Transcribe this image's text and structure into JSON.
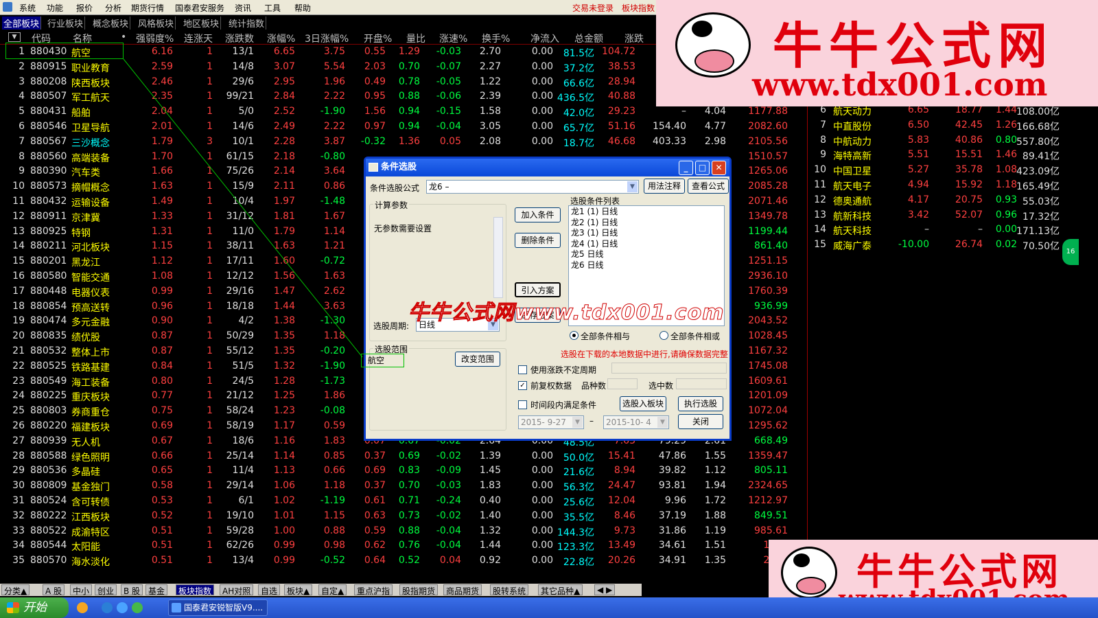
{
  "menubar": {
    "items": [
      "系统",
      "功能",
      "报价",
      "分析",
      "期货行情",
      "国泰君安服务",
      "资讯",
      "工具",
      "帮助"
    ],
    "right1": "交易未登录",
    "right2": "板块指数"
  },
  "tabs": [
    "全部板块",
    "行业板块",
    "概念板块",
    "风格板块",
    "地区板块",
    "统计指数"
  ],
  "columns": [
    "代码",
    "名称",
    "•",
    "强弱度%",
    "连涨天",
    "涨跌数",
    "涨幅%",
    "3日涨幅%",
    "开盘%",
    "量比",
    "涨速%",
    "换手%",
    "净流入",
    "总金额",
    "涨跌"
  ],
  "rows": [
    [
      "1",
      "880430",
      "航空",
      "6.16",
      "1",
      "13/1",
      "6.65",
      "3.75",
      "0.55",
      "1.29",
      "-0.03",
      "2.70",
      "0.00",
      "81.5亿",
      "104.72",
      "",
      "",
      ""
    ],
    [
      "2",
      "880915",
      "职业教育",
      "2.59",
      "1",
      "14/8",
      "3.07",
      "5.54",
      "2.03",
      "0.70",
      "-0.07",
      "2.27",
      "0.00",
      "37.2亿",
      "38.53",
      "",
      "",
      ""
    ],
    [
      "3",
      "880208",
      "陕西板块",
      "2.46",
      "1",
      "29/6",
      "2.95",
      "1.96",
      "0.49",
      "0.78",
      "-0.05",
      "1.22",
      "0.00",
      "66.6亿",
      "28.94",
      "",
      "",
      ""
    ],
    [
      "4",
      "880507",
      "军工航天",
      "2.35",
      "1",
      "99/21",
      "2.84",
      "2.22",
      "0.95",
      "0.88",
      "-0.06",
      "2.39",
      "0.00",
      "436.5亿",
      "40.88",
      "",
      "",
      ""
    ],
    [
      "5",
      "880431",
      "船舶",
      "2.04",
      "1",
      "5/0",
      "2.52",
      "-1.90",
      "1.56",
      "0.94",
      "-0.15",
      "1.58",
      "0.00",
      "42.0亿",
      "29.23",
      "–",
      "4.04",
      "1177.88"
    ],
    [
      "6",
      "880546",
      "卫星导航",
      "2.01",
      "1",
      "14/6",
      "2.49",
      "2.22",
      "0.97",
      "0.94",
      "-0.04",
      "3.05",
      "0.00",
      "65.7亿",
      "51.16",
      "154.40",
      "4.77",
      "2082.60"
    ],
    [
      "7",
      "880567",
      "三沙概念",
      "1.79",
      "3",
      "10/1",
      "2.28",
      "3.87",
      "-0.32",
      "1.36",
      "0.05",
      "2.08",
      "0.00",
      "18.7亿",
      "46.68",
      "403.33",
      "2.98",
      "2105.56"
    ],
    [
      "8",
      "880560",
      "高端装备",
      "1.70",
      "1",
      "61/15",
      "2.18",
      "-0.80",
      "",
      "",
      "",
      "",
      "",
      "",
      "",
      "",
      "",
      "1510.57"
    ],
    [
      "9",
      "880390",
      "汽车类",
      "1.66",
      "1",
      "75/26",
      "2.14",
      "3.64",
      "",
      "",
      "",
      "",
      "",
      "",
      "",
      "",
      "",
      "1265.06"
    ],
    [
      "10",
      "880573",
      "摘帽概念",
      "1.63",
      "1",
      "15/9",
      "2.11",
      "0.86",
      "",
      "",
      "",
      "",
      "",
      "",
      "",
      "",
      "",
      "2085.28"
    ],
    [
      "11",
      "880432",
      "运输设备",
      "1.49",
      "1",
      "10/4",
      "1.97",
      "-1.48",
      "",
      "",
      "",
      "",
      "",
      "",
      "",
      "",
      "",
      "2071.46"
    ],
    [
      "12",
      "880911",
      "京津冀",
      "1.33",
      "1",
      "31/12",
      "1.81",
      "1.67",
      "",
      "",
      "",
      "",
      "",
      "",
      "",
      "",
      "",
      "1349.78"
    ],
    [
      "13",
      "880925",
      "特钢",
      "1.31",
      "1",
      "11/0",
      "1.79",
      "1.14",
      "",
      "",
      "",
      "",
      "",
      "",
      "",
      "",
      "",
      "1199.44"
    ],
    [
      "14",
      "880211",
      "河北板块",
      "1.15",
      "1",
      "38/11",
      "1.63",
      "1.21",
      "",
      "",
      "",
      "",
      "",
      "",
      "",
      "",
      "",
      "861.40"
    ],
    [
      "15",
      "880201",
      "黑龙江",
      "1.12",
      "1",
      "17/11",
      "1.60",
      "-0.72",
      "",
      "",
      "",
      "",
      "",
      "",
      "",
      "",
      "",
      "1251.15"
    ],
    [
      "16",
      "880580",
      "智能交通",
      "1.08",
      "1",
      "12/12",
      "1.56",
      "1.63",
      "",
      "",
      "",
      "",
      "",
      "",
      "",
      "",
      "",
      "2936.10"
    ],
    [
      "17",
      "880448",
      "电器仪表",
      "0.99",
      "1",
      "29/16",
      "1.47",
      "2.62",
      "",
      "",
      "",
      "",
      "",
      "",
      "",
      "",
      "",
      "1760.39"
    ],
    [
      "18",
      "880854",
      "预高送转",
      "0.96",
      "1",
      "18/18",
      "1.44",
      "3.63",
      "",
      "",
      "",
      "",
      "",
      "",
      "",
      "",
      "",
      "936.99"
    ],
    [
      "19",
      "880474",
      "多元金融",
      "0.90",
      "1",
      "4/2",
      "1.38",
      "-1.30",
      "",
      "",
      "",
      "",
      "",
      "",
      "",
      "",
      "",
      "2043.52"
    ],
    [
      "20",
      "880835",
      "绩优股",
      "0.87",
      "1",
      "50/29",
      "1.35",
      "1.18",
      "",
      "",
      "",
      "",
      "",
      "",
      "",
      "",
      "",
      "1028.45"
    ],
    [
      "21",
      "880532",
      "整体上市",
      "0.87",
      "1",
      "55/12",
      "1.35",
      "-0.20",
      "",
      "",
      "",
      "",
      "",
      "",
      "",
      "",
      "",
      "1167.32"
    ],
    [
      "22",
      "880525",
      "铁路基建",
      "0.84",
      "1",
      "51/5",
      "1.32",
      "-1.90",
      "",
      "",
      "",
      "",
      "",
      "",
      "",
      "",
      "",
      "1745.08"
    ],
    [
      "23",
      "880549",
      "海工装备",
      "0.80",
      "1",
      "24/5",
      "1.28",
      "-1.73",
      "",
      "",
      "",
      "",
      "",
      "",
      "",
      "",
      "",
      "1609.61"
    ],
    [
      "24",
      "880225",
      "重庆板块",
      "0.77",
      "1",
      "21/12",
      "1.25",
      "1.86",
      "",
      "",
      "",
      "",
      "",
      "",
      "",
      "",
      "",
      "1201.09"
    ],
    [
      "25",
      "880803",
      "券商重仓",
      "0.75",
      "1",
      "58/24",
      "1.23",
      "-0.08",
      "",
      "",
      "",
      "",
      "",
      "",
      "",
      "",
      "",
      "1072.04"
    ],
    [
      "26",
      "880220",
      "福建板块",
      "0.69",
      "1",
      "58/19",
      "1.17",
      "0.59",
      "",
      "",
      "",
      "",
      "",
      "",
      "",
      "",
      "",
      "1295.62"
    ],
    [
      "27",
      "880939",
      "无人机",
      "0.67",
      "1",
      "18/6",
      "1.16",
      "1.83",
      "0.07",
      "0.67",
      "-0.02",
      "2.64",
      "0.00",
      "48.5亿",
      "7.63",
      "79.29",
      "2.61",
      "668.49"
    ],
    [
      "28",
      "880588",
      "绿色照明",
      "0.66",
      "1",
      "25/14",
      "1.14",
      "0.85",
      "0.37",
      "0.69",
      "-0.02",
      "1.39",
      "0.00",
      "50.0亿",
      "15.41",
      "47.86",
      "1.55",
      "1359.47"
    ],
    [
      "29",
      "880536",
      "多晶硅",
      "0.65",
      "1",
      "11/4",
      "1.13",
      "0.66",
      "0.69",
      "0.83",
      "-0.09",
      "1.45",
      "0.00",
      "21.6亿",
      "8.94",
      "39.82",
      "1.12",
      "805.11"
    ],
    [
      "30",
      "880809",
      "基金独门",
      "0.58",
      "1",
      "29/14",
      "1.06",
      "1.18",
      "0.37",
      "0.70",
      "-0.03",
      "1.83",
      "0.00",
      "56.3亿",
      "24.47",
      "93.81",
      "1.94",
      "2324.65"
    ],
    [
      "31",
      "880524",
      "含可转债",
      "0.53",
      "1",
      "6/1",
      "1.02",
      "-1.19",
      "0.61",
      "0.71",
      "-0.24",
      "0.40",
      "0.00",
      "25.6亿",
      "12.04",
      "9.96",
      "1.72",
      "1212.97"
    ],
    [
      "32",
      "880222",
      "江西板块",
      "0.52",
      "1",
      "19/10",
      "1.01",
      "1.15",
      "0.63",
      "0.73",
      "-0.02",
      "1.40",
      "0.00",
      "35.5亿",
      "8.46",
      "37.19",
      "1.88",
      "849.51"
    ],
    [
      "33",
      "880522",
      "成渝特区",
      "0.51",
      "1",
      "59/28",
      "1.00",
      "0.88",
      "0.59",
      "0.88",
      "-0.04",
      "1.32",
      "0.00",
      "144.3亿",
      "9.73",
      "31.86",
      "1.19",
      "985.61"
    ],
    [
      "34",
      "880544",
      "太阳能",
      "0.51",
      "1",
      "62/26",
      "0.99",
      "0.98",
      "0.62",
      "0.76",
      "-0.04",
      "1.44",
      "0.00",
      "123.3亿",
      "13.49",
      "34.61",
      "1.51",
      "1379"
    ],
    [
      "35",
      "880570",
      "海水淡化",
      "0.51",
      "1",
      "13/4",
      "0.99",
      "-0.52",
      "0.64",
      "0.52",
      "0.04",
      "0.92",
      "0.00",
      "22.8亿",
      "20.26",
      "34.91",
      "1.35",
      "2070"
    ]
  ],
  "right_list": [
    [
      "6",
      "航天动力",
      "6.65",
      "18.77",
      "1.44",
      "108.00亿"
    ],
    [
      "7",
      "中直股份",
      "6.50",
      "42.45",
      "1.26",
      "166.68亿"
    ],
    [
      "8",
      "中航动力",
      "5.83",
      "40.86",
      "0.80",
      "557.80亿"
    ],
    [
      "9",
      "海特高新",
      "5.51",
      "15.51",
      "1.46",
      "89.41亿"
    ],
    [
      "10",
      "中国卫星",
      "5.27",
      "35.78",
      "1.08",
      "423.09亿"
    ],
    [
      "11",
      "航天电子",
      "4.94",
      "15.92",
      "1.18",
      "165.49亿"
    ],
    [
      "12",
      "德奥通航",
      "4.17",
      "20.75",
      "0.93",
      "55.03亿"
    ],
    [
      "13",
      "航新科技",
      "3.42",
      "52.07",
      "0.96",
      "17.32亿"
    ],
    [
      "14",
      "航天科技",
      "–",
      "–",
      "0.00",
      "171.13亿"
    ],
    [
      "15",
      "威海广泰",
      "-10.00",
      "26.74",
      "0.02",
      "70.50亿"
    ]
  ],
  "side_badge": "16",
  "logo": {
    "text1": "牛牛公式网",
    "text2": "www.tdx001.com"
  },
  "dialog": {
    "title": "条件选股",
    "formula_label": "条件选股公式",
    "formula_value": "龙6             –",
    "usage_btn": "用法注释",
    "view_btn": "查看公式",
    "calc_group": "计算参数",
    "no_param": "无参数需要设置",
    "list_label": "选股条件列表",
    "conditions": [
      "龙1 (1) 日线",
      "龙2 (1) 日线",
      "龙3 (1) 日线",
      "龙4 (1) 日线",
      "龙5 日线",
      "龙6 日线"
    ],
    "add_btn": "加入条件",
    "del_btn": "删除条件",
    "import_btn": "引入方案",
    "save_btn": "保存方案",
    "period_label": "选股周期:",
    "period_value": "日线",
    "and_label": "全部条件相与",
    "or_label": "全部条件相或",
    "range_group": "选股范围",
    "range_value": "航空",
    "change_range_btn": "改变范围",
    "warning": "选股在下载的本地数据中进行,请确保数据完整",
    "chk_unfixed": "使用涨跌不定周期",
    "chk_rights": "前复权数据",
    "count_label": "品种数",
    "selected_label": "选中数",
    "chk_time": "时间段内满足条件",
    "to_block_btn": "选股入板块",
    "exec_btn": "执行选股",
    "date_from": "2015- 9-27",
    "date_sep": "–",
    "date_to": "2015-10- 4",
    "close_btn": "关闭"
  },
  "watermark": "牛牛公式网www.tdx001.com",
  "bottom_tabs": [
    "分类▲",
    "A 股",
    "中小",
    "创业",
    "B 股",
    "基金",
    "板块指数",
    "AH对照",
    "自选",
    "板块▲",
    "自定▲",
    "重点沪指",
    "股指期货",
    "商品期货",
    "股转系统",
    "其它品种▲"
  ],
  "taskbar": {
    "start": "开始",
    "item": "国泰君安锐智版V9...."
  }
}
